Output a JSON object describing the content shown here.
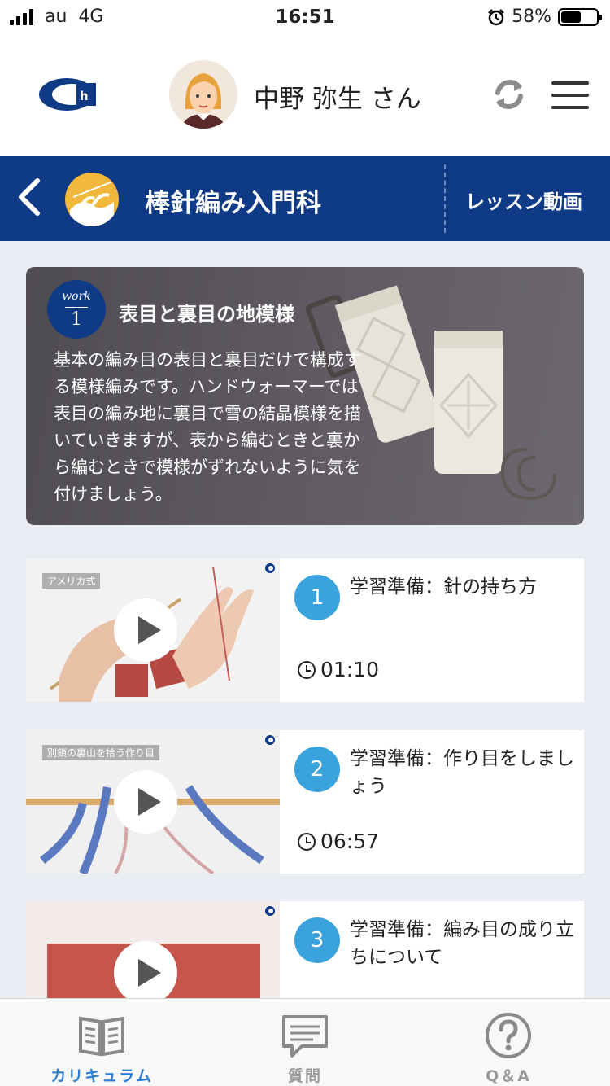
{
  "status_bar": {
    "carrier": "au",
    "network": "4G",
    "time": "16:51",
    "battery_text": "58%",
    "battery_level": 0.58
  },
  "header": {
    "user_name": "中野 弥生 さん"
  },
  "course": {
    "title": "棒針編み入門科",
    "lesson_video_link": "レッスン動画"
  },
  "work": {
    "badge_label": "work",
    "badge_number": "1",
    "title": "表目と裏目の地模様",
    "description": "基本の編み目の表目と裏目だけで構成する模様編みです。ハンドウォーマーでは表目の編み地に裏目で雪の結晶模様を描いていきますが、表から編むときと裏から編むときで模様がずれないように気を付けましょう。"
  },
  "lessons": [
    {
      "number": "1",
      "title": "学習準備：針の持ち方",
      "duration": "01:10",
      "thumb_label": "アメリカ式"
    },
    {
      "number": "2",
      "title": "学習準備：作り目をしましょう",
      "duration": "06:57",
      "thumb_label": "別鎖の裏山を拾う作り目"
    },
    {
      "number": "3",
      "title": "学習準備：編み目の成り立ちについて",
      "duration": "",
      "thumb_label": ""
    }
  ],
  "tabs": [
    {
      "label": "カリキュラム",
      "icon": "book-icon",
      "active": true
    },
    {
      "label": "質問",
      "icon": "chat-icon",
      "active": false
    },
    {
      "label": "Q＆A",
      "icon": "question-icon",
      "active": false
    }
  ],
  "colors": {
    "brand_navy": "#0e3a86",
    "accent_blue": "#3aa2dc",
    "active_tab": "#2d7fd3"
  }
}
